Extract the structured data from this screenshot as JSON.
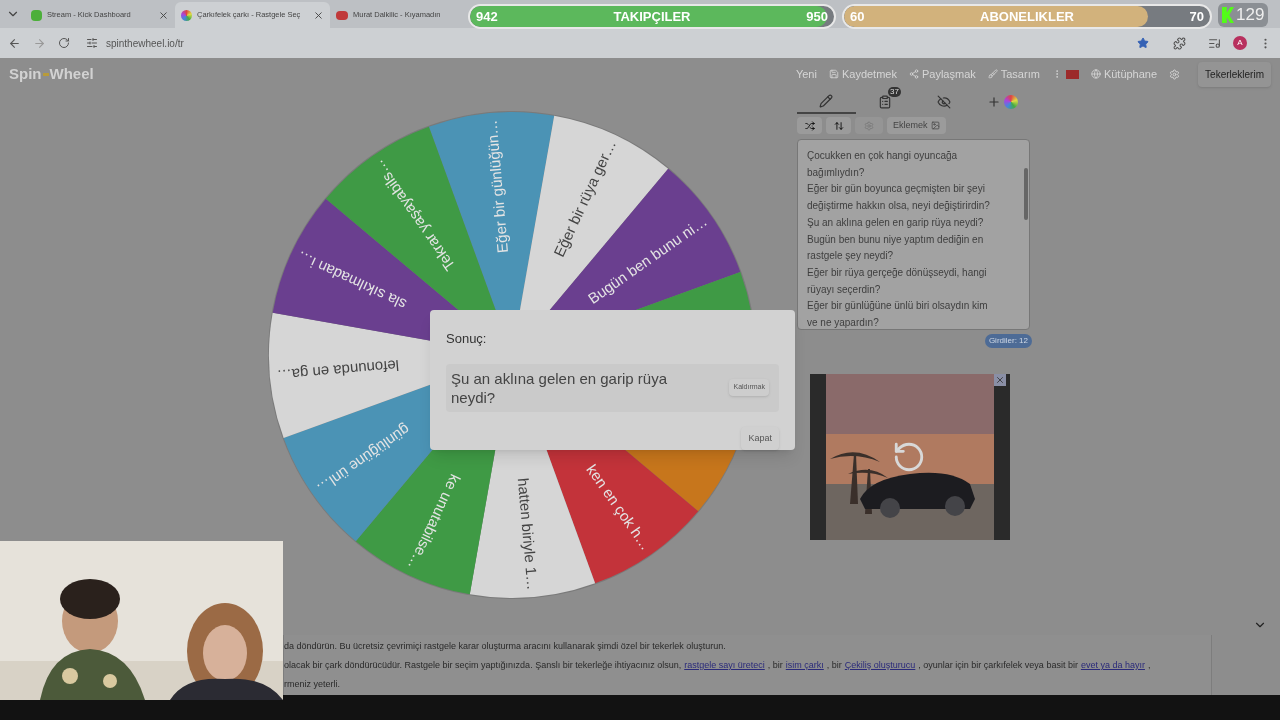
{
  "browser": {
    "tabs": [
      {
        "title": "Stream - Kick Dashboard",
        "selected": false
      },
      {
        "title": "Çarkıfelek çarkı - Rastgele Seç",
        "selected": true
      },
      {
        "title": "Murat Dalkilic - Kıyamadın",
        "selected": false
      }
    ],
    "address": "spinthewheel.io/tr",
    "profile": "A"
  },
  "stream_overlay": {
    "goals": [
      {
        "start": "942",
        "label": "TAKIPÇILER",
        "target": "950",
        "level": 0.98,
        "color": "#5cb85c"
      },
      {
        "start": "60",
        "label": "ABONELIKLER",
        "target": "70",
        "level": 0.83,
        "color": "#d2b27c"
      }
    ],
    "viewer_count": "129"
  },
  "site": {
    "logo": [
      "Spin",
      "Wheel"
    ],
    "nav": [
      "Yeni",
      "Kaydetmek",
      "Paylaşmak",
      "Tasarım",
      "Kütüphane"
    ],
    "account_button": "Tekerleklerim"
  },
  "wheel": {
    "segments": [
      {
        "color": "#4b93b5",
        "label": "Eğer bir günlüğün…"
      },
      {
        "color": "#d6d6d6",
        "label": "Eğer bir rüya ger…"
      },
      {
        "color": "#6a3f8f",
        "label": "Bugün ben bunu ni…"
      },
      {
        "color": "#3f9a45"
      },
      {
        "color": "#c7761c"
      },
      {
        "color": "#c3333a",
        "label": "ken en çok h…"
      },
      {
        "color": "#d6d6d6",
        "label": "hatten biriyle 1…"
      },
      {
        "color": "#3f9a45",
        "label": "ke unutabilse…"
      },
      {
        "color": "#4b93b5",
        "label": "günlüğüne ünl…"
      },
      {
        "color": "#d6d6d6",
        "label": "lefonunda en ga…"
      },
      {
        "color": "#6a3f8f",
        "label": "sla sıkılmadan i…"
      },
      {
        "color": "#3f9a45",
        "label": "Tekrar yaşayabils…"
      }
    ]
  },
  "editor": {
    "tabs": [
      {
        "selected": true
      },
      {
        "selected": false,
        "badge": "37"
      },
      {
        "selected": false
      },
      {
        "selected": false
      }
    ],
    "add_button": "Eklemek",
    "lines": [
      "Çocukken en çok hangi oyuncağa",
      "bağımlıydın?",
      "Eğer bir gün boyunca geçmişten bir şeyi",
      "değiştirme hakkın olsa, neyi değiştirirdin?",
      "Şu an aklına gelen en garip rüya neydi?",
      "Bugün ben bunu niye yaptım dediğin en",
      "rastgele şey neydi?",
      "Eğer bir rüya gerçeğe dönüşseydi, hangi",
      "rüyayı seçerdin?",
      "Eğer bir günlüğüne ünlü biri olsaydın kim",
      "ve ne yapardın?"
    ],
    "count": "Girdiler: 12"
  },
  "dialog": {
    "title": "Sonuç:",
    "result": "Şu an aklına gelen en garip rüya neydi?",
    "remove_button": "Kaldırmak",
    "close_button": "Kapat"
  },
  "article": {
    "lines": [
      [
        {
          "kind": "text",
          "text": "da döndürün. Bu ücretsiz çevrimiçi rastgele karar oluşturma aracını kullanarak şimdi özel bir tekerlek oluşturun."
        }
      ],
      [
        {
          "kind": "text",
          "text": "olacak bir çark döndürücüdür. Rastgele bir seçim yaptığınızda. Şanslı bir tekerleğe ihtiyacınız olsun,"
        },
        {
          "kind": "link",
          "text": "rastgele sayı üreteci"
        },
        {
          "kind": "text",
          "text": ", bir"
        },
        {
          "kind": "link",
          "text": "isim çarkı"
        },
        {
          "kind": "text",
          "text": ", bir"
        },
        {
          "kind": "link",
          "text": "Çekiliş oluşturucu"
        },
        {
          "kind": "text",
          "text": ", oyunlar için bir çarkıfelek veya basit bir"
        },
        {
          "kind": "link",
          "text": "evet ya da hayır"
        },
        {
          "kind": "text",
          "text": ","
        }
      ],
      [
        {
          "kind": "text",
          "text": "rmeniz yeterli."
        }
      ]
    ]
  }
}
